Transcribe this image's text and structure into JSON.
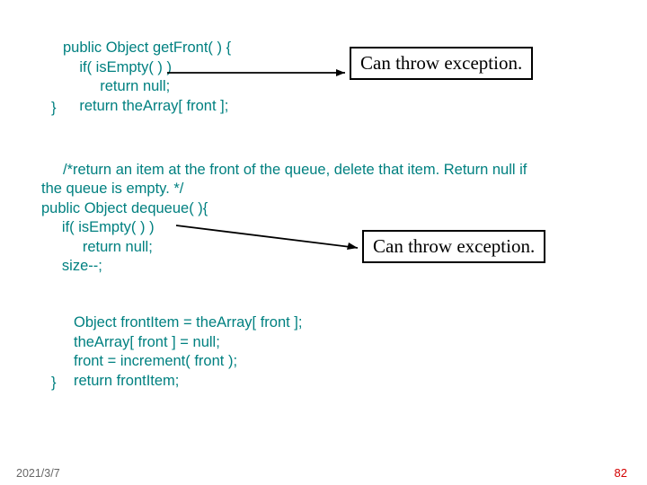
{
  "block1": {
    "l1": "public Object getFront( ) {",
    "l2": "    if( isEmpty( ) )",
    "l3": "         return null;",
    "l4": "    return theArray[ front ];",
    "l5": "}"
  },
  "block2": {
    "l1": "/*return an item at the front of the queue, delete that item. Return null if",
    "l2": "the queue is empty. */",
    "l3": "public Object dequeue( ){",
    "l4": "     if( isEmpty( ) )",
    "l5": "          return null;",
    "l6": "     size--;"
  },
  "block3": {
    "l1": "Object frontItem = theArray[ front ];",
    "l2": "theArray[ front ] = null;",
    "l3": "front = increment( front );",
    "l4": "return frontItem;",
    "l5": "}"
  },
  "callouts": {
    "ex1": "Can throw exception.",
    "ex2": "Can throw exception."
  },
  "footer": {
    "date": "2021/3/7",
    "page": "82"
  }
}
